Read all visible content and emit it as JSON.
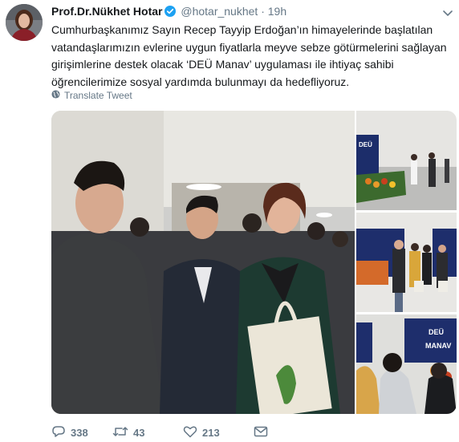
{
  "author": {
    "name": "Prof.Dr.Nükhet Hotar",
    "handle": "@hotar_nukhet",
    "separator": "·",
    "time": "19h"
  },
  "tweet": {
    "text": "Cumhurbaşkanımız Sayın Recep Tayyip Erdoğan’ın himayelerinde başlatılan vatandaşlarımızın evlerine uygun fiyatlarla meyve sebze götürmelerini sağlayan girişimlerine destek olacak ‘DEÜ Manav’ uygulaması ile ihtiyaç sahibi öğrencilerimize sosyal yardımda bulunmayı da hedefliyoruz.",
    "translate_label": "Translate Tweet"
  },
  "media": {
    "banner_text_1": "DEÜ",
    "banner_text_2": "MANAV",
    "banner_text_3": "DEÜ",
    "banner_text_4": "MANAV"
  },
  "actions": {
    "replies": "338",
    "retweets": "43",
    "likes": "213"
  },
  "icons": [
    "verified-icon",
    "caret-down-icon",
    "globe-icon",
    "reply-icon",
    "retweet-icon",
    "like-icon",
    "message-icon"
  ],
  "colors": {
    "verified": "#1da1f2",
    "secondary": "#657786",
    "text": "#14171a"
  }
}
